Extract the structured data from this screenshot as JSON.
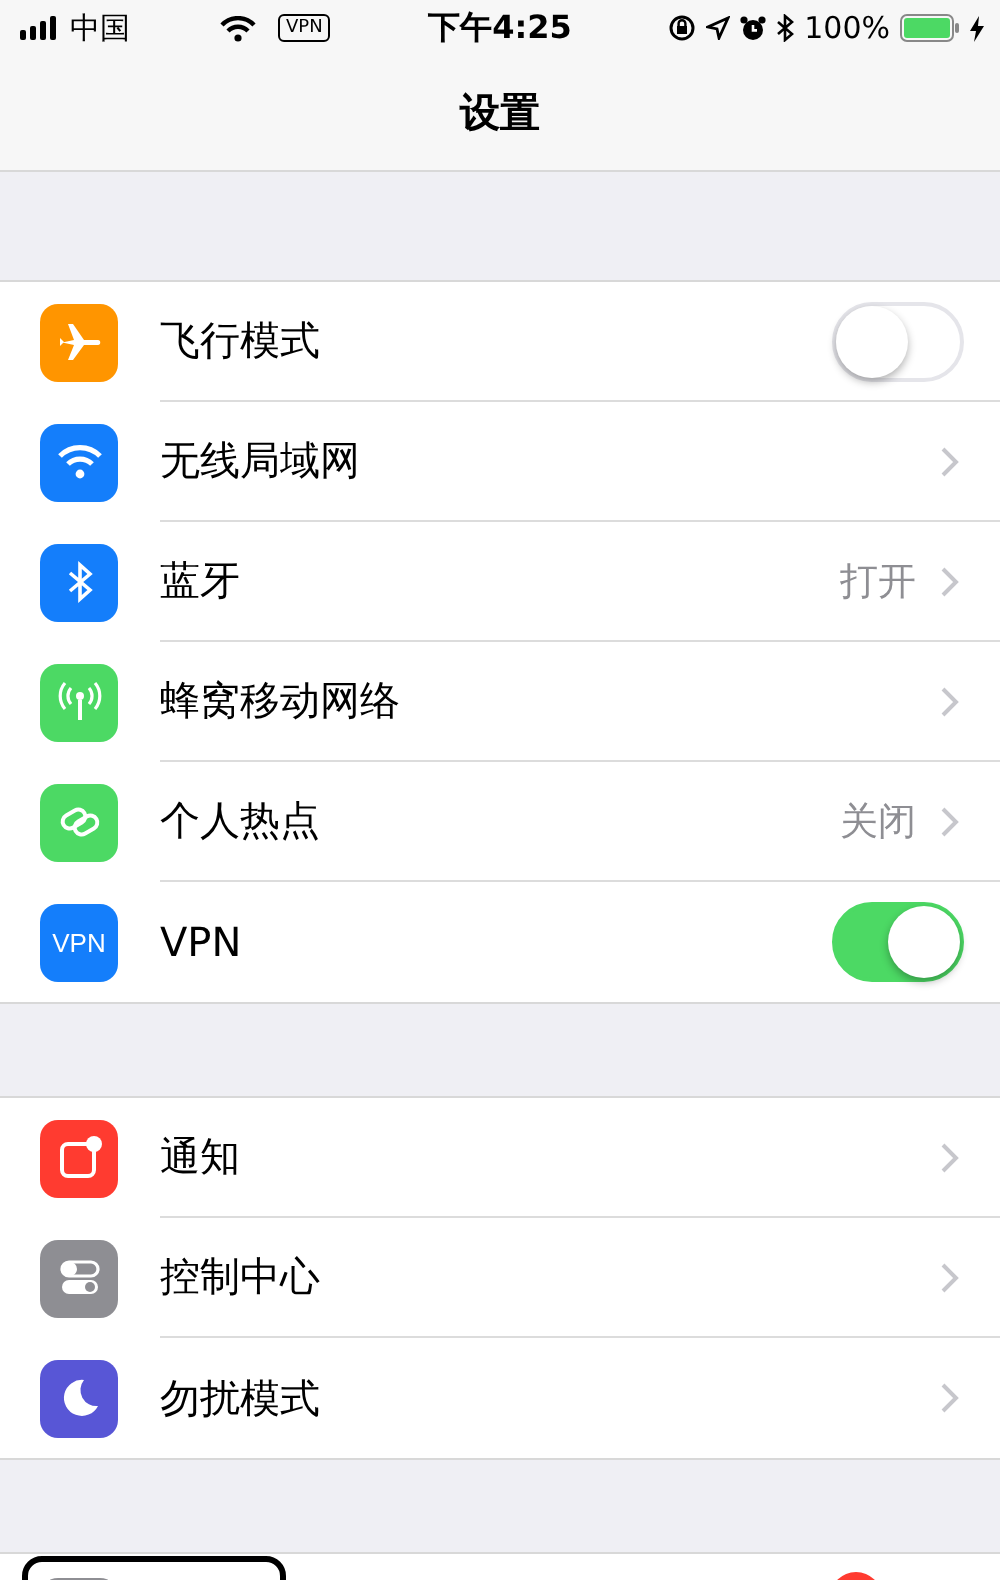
{
  "status_bar": {
    "carrier": "中国",
    "vpn": "VPN",
    "time": "下午4:25",
    "battery": "100%"
  },
  "nav": {
    "title": "设置"
  },
  "groups": [
    {
      "rows": [
        {
          "label": "飞行模式",
          "color": "#ff9500",
          "kind": "toggle",
          "on": false
        },
        {
          "label": "无线局域网",
          "color": "#147efb",
          "kind": "link"
        },
        {
          "label": "蓝牙",
          "color": "#147efb",
          "kind": "link",
          "value": "打开"
        },
        {
          "label": "蜂窝移动网络",
          "color": "#4cd964",
          "kind": "link"
        },
        {
          "label": "个人热点",
          "color": "#4cd964",
          "kind": "link",
          "value": "关闭"
        },
        {
          "label": "VPN",
          "color": "#147efb",
          "kind": "toggle",
          "on": true,
          "icon_text": "VPN"
        }
      ]
    },
    {
      "rows": [
        {
          "label": "通知",
          "color": "#ff3b30",
          "kind": "link"
        },
        {
          "label": "控制中心",
          "color": "#8e8e93",
          "kind": "link"
        },
        {
          "label": "勿扰模式",
          "color": "#5856d6",
          "kind": "link"
        }
      ]
    }
  ],
  "partial_row": {
    "color": "#8e8e93",
    "badge": true,
    "highlight_frame": true
  }
}
